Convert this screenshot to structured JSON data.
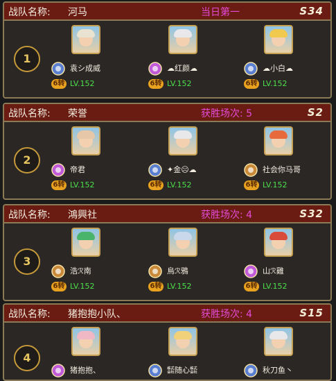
{
  "label_team": "战队名称:",
  "turn_label": "6转",
  "teams": [
    {
      "rank": "1",
      "name": "河马",
      "stat": "当日第一",
      "server": "S34",
      "members": [
        {
          "name": "袁シ成威",
          "level": "LV.152",
          "badge_color": "#5a7fd0",
          "hair": "#e9e2d0"
        },
        {
          "name": "☁红颜☁",
          "level": "LV.152",
          "badge_color": "#c05ad8",
          "hair": "#e8e8ea"
        },
        {
          "name": "☁小白☁",
          "level": "LV.152",
          "badge_color": "#5a7fd0",
          "hair": "#f1c94e"
        }
      ]
    },
    {
      "rank": "2",
      "name": "荣誉",
      "stat": "获胜场次: 5",
      "server": "S2",
      "members": [
        {
          "name": "帝君",
          "level": "LV.152",
          "badge_color": "#c05ad8",
          "hair": "#e6c7a8"
        },
        {
          "name": "✦金☹☁",
          "level": "LV.152",
          "badge_color": "#5a7fd0",
          "hair": "#e8e8ea"
        },
        {
          "name": "社会你马哥",
          "level": "LV.152",
          "badge_color": "#c98a3a",
          "hair": "#e76a3d"
        }
      ]
    },
    {
      "rank": "3",
      "name": "鴻興社",
      "stat": "获胜场次: 4",
      "server": "S32",
      "members": [
        {
          "name": "浩ℛ南",
          "level": "LV.152",
          "badge_color": "#c98a3a",
          "hair": "#49b46b"
        },
        {
          "name": "烏ℛ鴉",
          "level": "LV.152",
          "badge_color": "#c98a3a",
          "hair": "#c9d8ea"
        },
        {
          "name": "山ℛ雞",
          "level": "LV.152",
          "badge_color": "#c05ad8",
          "hair": "#d84a3a"
        }
      ]
    },
    {
      "rank": "4",
      "name": "猪抱抱小队、",
      "stat": "获胜场次: 4",
      "server": "S15",
      "members": [
        {
          "name": "猪抱抱、",
          "level": "LV.152",
          "badge_color": "#c05ad8",
          "hair": "#f0b8c4"
        },
        {
          "name": "㍿随心㍿",
          "level": "LV.152",
          "badge_color": "#5a7fd0",
          "hair": "#f1d27a"
        },
        {
          "name": "秋刀鱼丶",
          "level": "LV.152",
          "badge_color": "#5a7fd0",
          "hair": "#e8e8ea"
        }
      ]
    }
  ]
}
